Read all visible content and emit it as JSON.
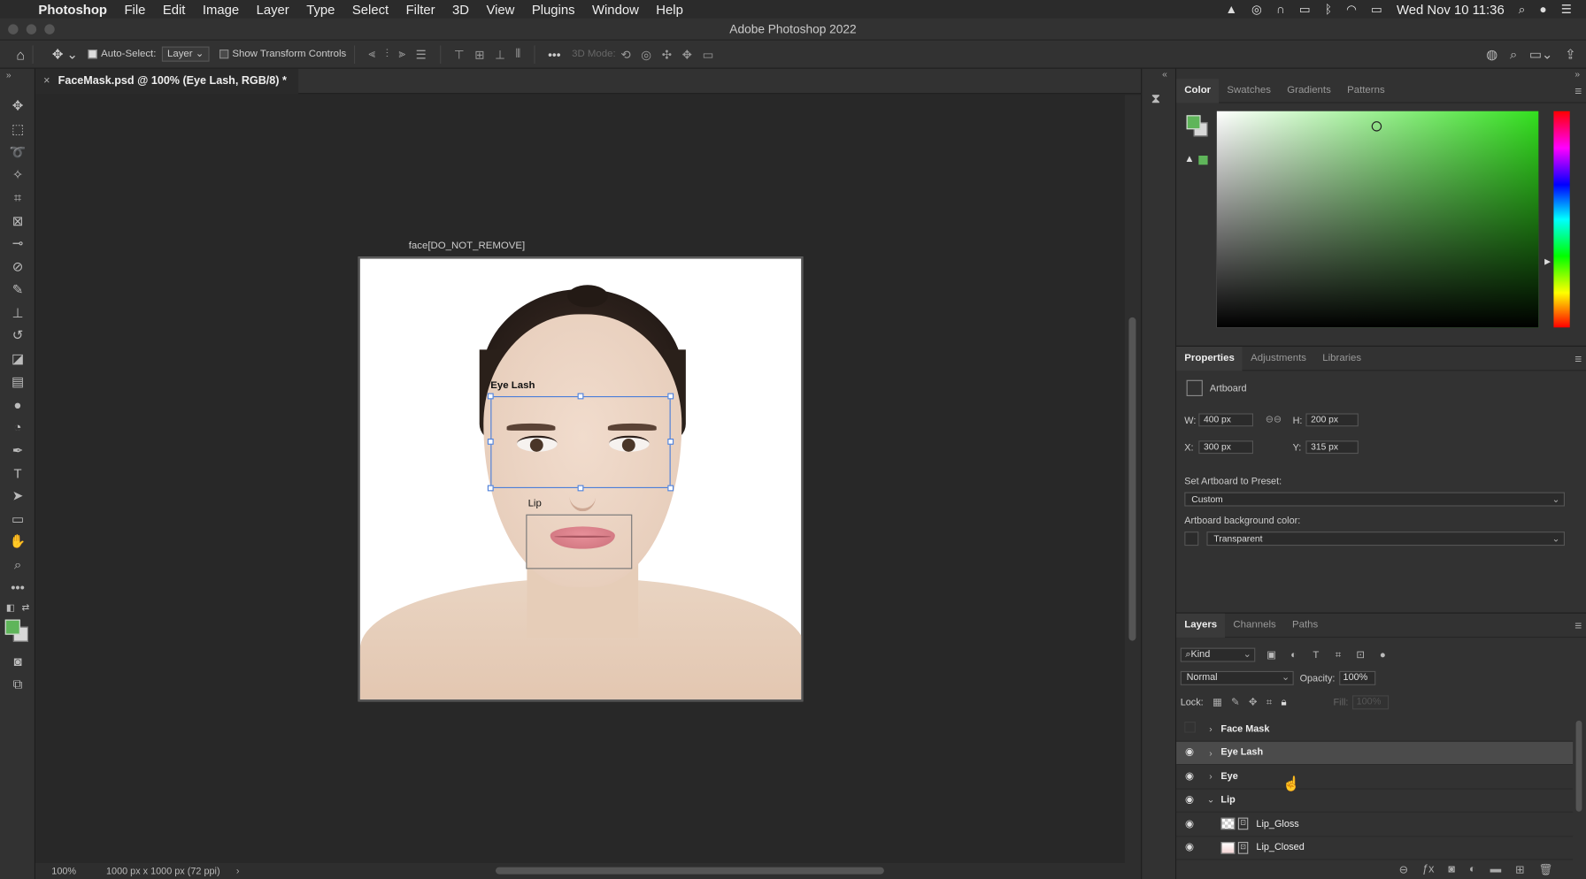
{
  "menubar": {
    "app_name": "Photoshop",
    "items": [
      "File",
      "Edit",
      "Image",
      "Layer",
      "Type",
      "Select",
      "Filter",
      "3D",
      "View",
      "Plugins",
      "Window",
      "Help"
    ],
    "clock": "Wed Nov 10  11:36"
  },
  "window": {
    "title": "Adobe Photoshop 2022"
  },
  "options": {
    "auto_select_label": "Auto-Select:",
    "auto_select_value": "Layer",
    "show_transform_label": "Show Transform Controls",
    "mode_3d_label": "3D Mode:"
  },
  "document": {
    "tab_title": "FaceMask.psd @ 100% (Eye Lash, RGB/8) *",
    "artboard_name": "face[DO_NOT_REMOVE]",
    "labels": {
      "eye_lash": "Eye Lash",
      "lip": "Lip"
    }
  },
  "status": {
    "zoom": "100%",
    "doc_size": "1000 px x 1000 px (72 ppi)",
    "arrow": "›"
  },
  "color_panel": {
    "tabs": [
      "Color",
      "Swatches",
      "Gradients",
      "Patterns"
    ],
    "active_tab": "Color",
    "foreground": "#5fb55a",
    "background": "#d8d8d8"
  },
  "properties_panel": {
    "tabs": [
      "Properties",
      "Adjustments",
      "Libraries"
    ],
    "type_label": "Artboard",
    "w_label": "W:",
    "w_value": "400 px",
    "h_label": "H:",
    "h_value": "200 px",
    "x_label": "X:",
    "x_value": "300 px",
    "y_label": "Y:",
    "y_value": "315 px",
    "preset_label": "Set Artboard to Preset:",
    "preset_value": "Custom",
    "bg_label": "Artboard background color:",
    "bg_value": "Transparent"
  },
  "layers_panel": {
    "tabs": [
      "Layers",
      "Channels",
      "Paths"
    ],
    "kind_filter": "Kind",
    "blend_mode": "Normal",
    "opacity_label": "Opacity:",
    "opacity_value": "100%",
    "lock_label": "Lock:",
    "fill_label": "Fill:",
    "fill_value": "100%",
    "layers": [
      {
        "name": "Face Mask",
        "visible": false,
        "expanded": false,
        "selected": false
      },
      {
        "name": "Eye Lash",
        "visible": true,
        "expanded": false,
        "selected": true
      },
      {
        "name": "Eye",
        "visible": true,
        "expanded": false,
        "selected": false
      },
      {
        "name": "Lip",
        "visible": true,
        "expanded": true,
        "selected": false
      },
      {
        "name": "Lip_Gloss",
        "visible": true,
        "child": true
      },
      {
        "name": "Lip_Closed",
        "visible": true,
        "child": true
      }
    ]
  },
  "accent": "#4d7fd9"
}
